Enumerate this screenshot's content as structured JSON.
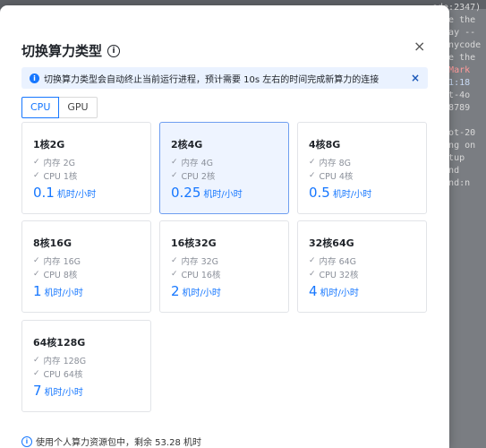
{
  "background": {
    "lines": [
      {
        "text": "ode:2347) [DEP0040] DeprecationWarning: The `punycode`",
        "tone": "plain"
      },
      {
        "text": "here the",
        "tone": "plain"
      },
      {
        "text": "teway --",
        "tone": "plain"
      },
      {
        "text": "`punycode",
        "tone": "plain"
      },
      {
        "text": "",
        "tone": "plain"
      },
      {
        "text": "here the",
        "tone": "plain"
      },
      {
        "text": "",
        "tone": "plain"
      },
      {
        "text": "ot Mark",
        "tone": "red"
      },
      {
        "text": "",
        "tone": "plain"
      },
      {
        "text": ".0.1:18",
        "tone": "blue"
      },
      {
        "text": "",
        "tone": "plain"
      },
      {
        "text": "",
        "tone": "plain"
      },
      {
        "text": "/gpt-4o",
        "tone": "plain"
      },
      {
        "text": "t:18789",
        "tone": "plain"
      },
      {
        "text": "789",
        "tone": "plain"
      },
      {
        "text": "wdbot-20",
        "tone": "plain"
      },
      {
        "text": "ening on",
        "tone": "plain"
      },
      {
        "text": "tartup",
        "tone": "plain"
      },
      {
        "text": "mmand",
        "tone": "plain"
      },
      {
        "text": "mmand:n",
        "tone": "plain"
      },
      {
        "text": "ers",
        "tone": "plain"
      }
    ]
  },
  "modal": {
    "title": "切换算力类型",
    "title_icon": "info-icon",
    "close_glyph": "×",
    "notice": {
      "icon": "info-icon",
      "text": "切换算力类型会自动终止当前运行进程，预计需要 10s 左右的时间完成新算力的连接",
      "close_glyph": "×"
    },
    "tabs": [
      {
        "label": "CPU",
        "active": true
      },
      {
        "label": "GPU",
        "active": false
      }
    ],
    "check_glyph": "✓",
    "cards": [
      {
        "name": "1核2G",
        "memory": "内存 2G",
        "cpu": "CPU 1核",
        "price": "0.1",
        "unit": "机时/小时",
        "selected": false
      },
      {
        "name": "2核4G",
        "memory": "内存 4G",
        "cpu": "CPU 2核",
        "price": "0.25",
        "unit": "机时/小时",
        "selected": true
      },
      {
        "name": "4核8G",
        "memory": "内存 8G",
        "cpu": "CPU 4核",
        "price": "0.5",
        "unit": "机时/小时",
        "selected": false
      },
      {
        "name": "8核16G",
        "memory": "内存 16G",
        "cpu": "CPU 8核",
        "price": "1",
        "unit": "机时/小时",
        "selected": false
      },
      {
        "name": "16核32G",
        "memory": "内存 32G",
        "cpu": "CPU 16核",
        "price": "2",
        "unit": "机时/小时",
        "selected": false
      },
      {
        "name": "32核64G",
        "memory": "内存 64G",
        "cpu": "CPU 32核",
        "price": "4",
        "unit": "机时/小时",
        "selected": false
      },
      {
        "name": "64核128G",
        "memory": "内存 128G",
        "cpu": "CPU 64核",
        "price": "7",
        "unit": "机时/小时",
        "selected": false
      }
    ],
    "footer": {
      "icon": "info-icon",
      "text": "使用个人算力资源包中，剩余 53.28 机时"
    }
  },
  "colors": {
    "accent": "#1677ff",
    "notice_bg": "#eaf2ff",
    "selected_card_bg": "#eef4ff"
  }
}
